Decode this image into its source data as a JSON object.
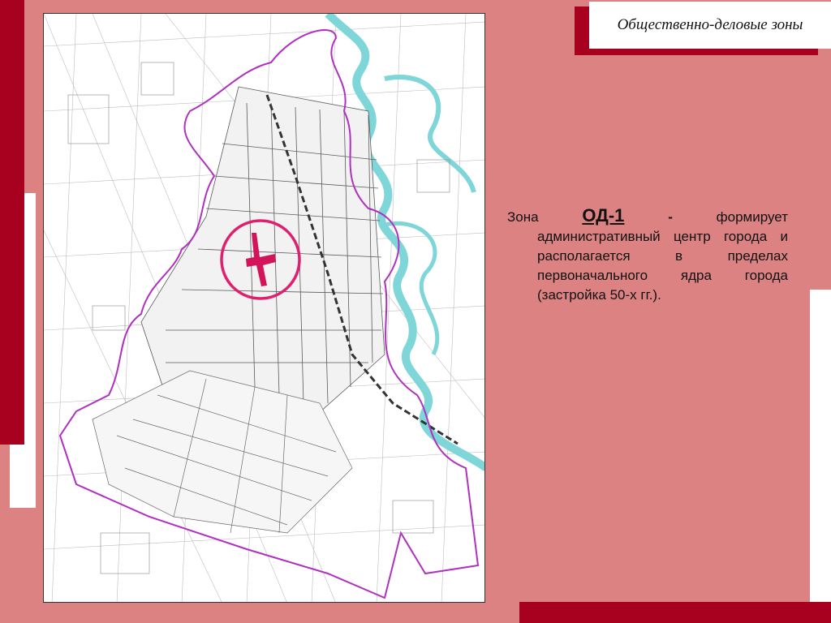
{
  "slide": {
    "title": "Общественно-деловые зоны",
    "colors": {
      "background": "#dc8282",
      "accent": "#a8001f",
      "highlight": "#e0206e",
      "water": "#7fd6d9",
      "boundary": "#b030c0"
    }
  },
  "map": {
    "highlighted_zone": "ОД-1",
    "features": [
      "city-plan",
      "river",
      "railway",
      "city-boundary",
      "zone-circle-marker"
    ]
  },
  "description": {
    "prefix": "Зона",
    "zone_code": "ОД-1",
    "dash": "-",
    "verb": "формирует",
    "body": "административный центр города и располагается в пределах первоначального ядра города (застройка 50-х гг.)."
  }
}
